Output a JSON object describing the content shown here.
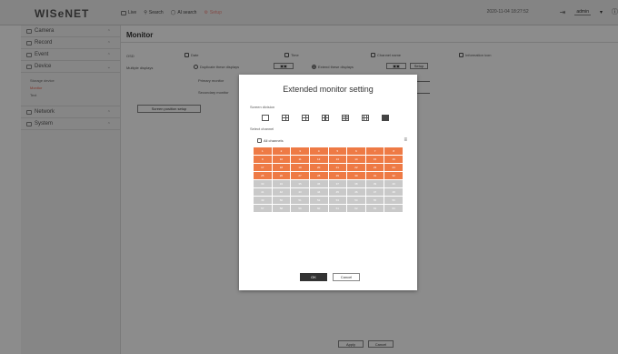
{
  "app": {
    "logo": "WISeNET"
  },
  "topnav": [
    {
      "label": "Live",
      "icon": "monitor-icon"
    },
    {
      "label": "Search",
      "icon": "search-icon"
    },
    {
      "label": "AI search",
      "icon": "ai-search-icon"
    },
    {
      "label": "Setup",
      "icon": "setup-icon"
    }
  ],
  "topright": {
    "datetime": "2020-11-04 18:27:52",
    "user": "admin"
  },
  "sidebar": {
    "items": [
      {
        "label": "Camera",
        "icon": "camera-icon"
      },
      {
        "label": "Record",
        "icon": "record-icon"
      },
      {
        "label": "Event",
        "icon": "event-icon"
      },
      {
        "label": "Device",
        "icon": "device-icon"
      }
    ],
    "device_sub": [
      "Storage device",
      "Monitor",
      "Text"
    ],
    "items2": [
      {
        "label": "Network",
        "icon": "network-icon"
      },
      {
        "label": "System",
        "icon": "system-icon"
      }
    ]
  },
  "main": {
    "title": "Monitor",
    "osd_label": "OSD",
    "osd_options": [
      "Date",
      "Time",
      "Channel name",
      "Information icon"
    ],
    "multiple_displays_label": "Multiple displays",
    "duplicate_label": "Duplicate these displays",
    "extend_label": "Extend these displays",
    "setup_btn": "Setup",
    "primary_label": "Primary monitor",
    "secondary_label": "Secondary monitor",
    "screen_position_btn": "Screen position setup",
    "apply_btn": "Apply",
    "cancel_btn": "Cancel"
  },
  "modal": {
    "title": "Extended monitor setting",
    "screen_division_label": "Screen division",
    "select_channel_label": "Select channel",
    "all_channels_label": "All channels",
    "channels": [
      "1",
      "2",
      "3",
      "4",
      "5",
      "6",
      "7",
      "8",
      "9",
      "10",
      "11",
      "12",
      "13",
      "14",
      "15",
      "16",
      "17",
      "18",
      "19",
      "20",
      "21",
      "22",
      "23",
      "24",
      "25",
      "26",
      "27",
      "28",
      "29",
      "30",
      "31",
      "32",
      "33",
      "34",
      "35",
      "36",
      "37",
      "38",
      "39",
      "40",
      "41",
      "42",
      "43",
      "44",
      "45",
      "46",
      "47",
      "48",
      "49",
      "50",
      "51",
      "52",
      "53",
      "54",
      "55",
      "56",
      "57",
      "58",
      "59",
      "60",
      "61",
      "62",
      "63",
      "64"
    ],
    "selected_count": 32,
    "ok_btn": "OK",
    "cancel_btn": "Cancel"
  },
  "colors": {
    "accent": "#ee7a45",
    "setup_nav": "#f08a82"
  }
}
